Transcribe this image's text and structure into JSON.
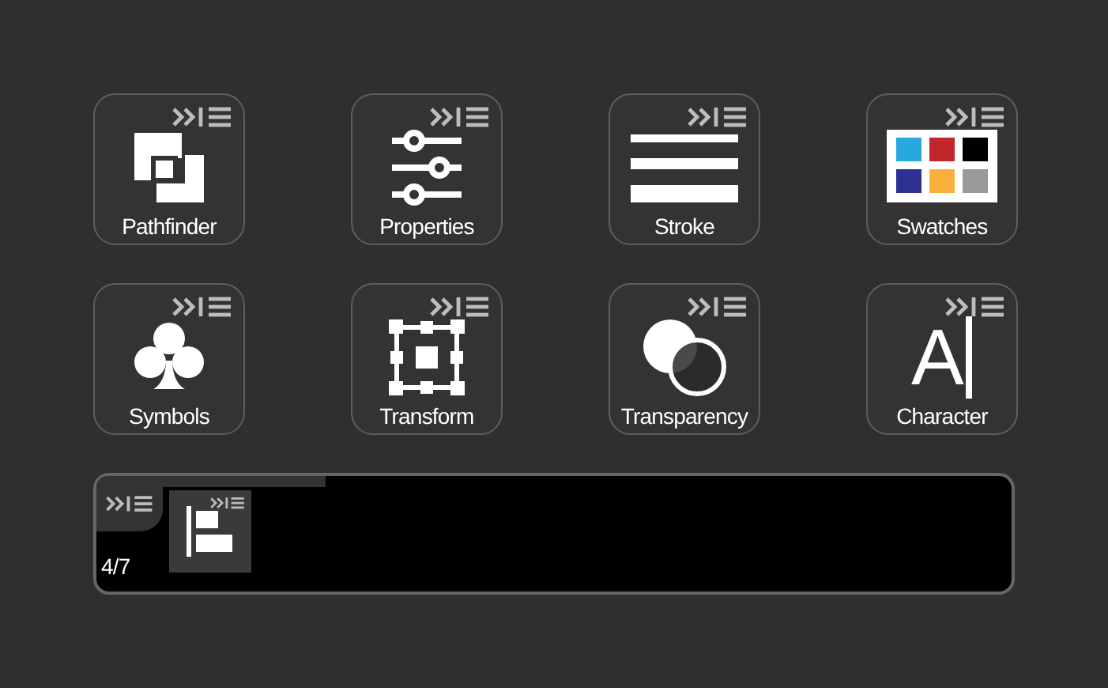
{
  "panels": [
    {
      "kind": "pathfinder",
      "label": "Pathfinder"
    },
    {
      "kind": "properties",
      "label": "Properties"
    },
    {
      "kind": "stroke",
      "label": "Stroke"
    },
    {
      "kind": "swatches",
      "label": "Swatches"
    },
    {
      "kind": "symbols",
      "label": "Symbols"
    },
    {
      "kind": "transform",
      "label": "Transform"
    },
    {
      "kind": "transparency",
      "label": "Transparency"
    },
    {
      "kind": "character",
      "label": "Character",
      "glyph": "A"
    }
  ],
  "dock": {
    "counter": "4/7",
    "items": [
      {
        "kind": "align"
      }
    ]
  }
}
